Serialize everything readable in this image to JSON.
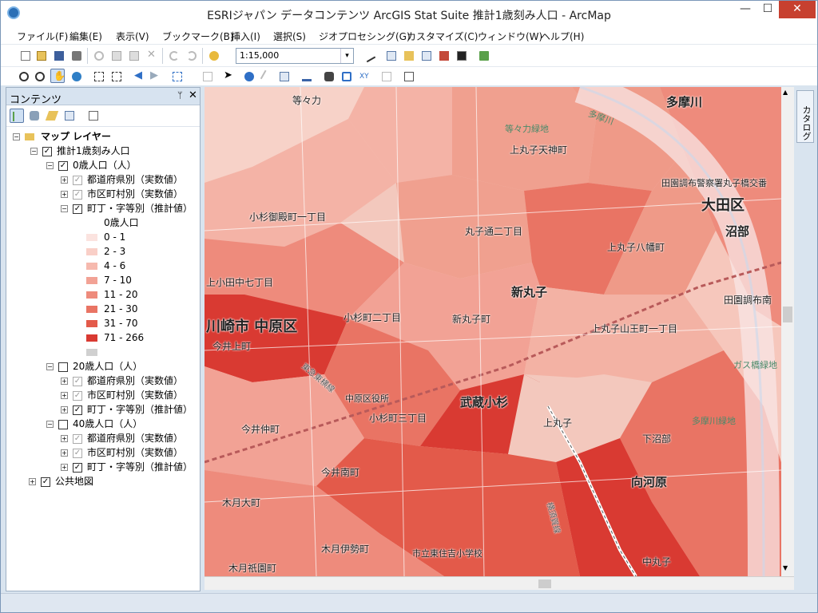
{
  "window": {
    "title": "ESRIジャパン データコンテンツ ArcGIS Stat Suite 推計1歳刻み人口 - ArcMap",
    "min_glyph": "—",
    "max_glyph": "☐",
    "close_glyph": "✕"
  },
  "menu": [
    "ファイル(F)",
    "編集(E)",
    "表示(V)",
    "ブックマーク(B)",
    "挿入(I)",
    "選択(S)",
    "ジオプロセシング(G)",
    "カスタマイズ(C)",
    "ウィンドウ(W)",
    "ヘルプ(H)"
  ],
  "toolbar": {
    "scale_value": "1:15,000",
    "dropdown_glyph": "▾"
  },
  "toc": {
    "title": "コンテンツ",
    "pin_glyph": "ᛘ",
    "close_glyph": "✕",
    "map_layer": "マップ レイヤー",
    "group": "推計1歳刻み人口",
    "age0": {
      "label": "0歳人口（人）",
      "pref": "都道府県別（実数値）",
      "city": "市区町村別（実数値）",
      "town": "町丁・字等別（推計値）",
      "legend_title": "0歳人口"
    },
    "legend": [
      {
        "label": "0 - 1",
        "color": "#fbe3df"
      },
      {
        "label": "2 - 3",
        "color": "#f9cfc7"
      },
      {
        "label": "4 - 6",
        "color": "#f6b9ae"
      },
      {
        "label": "7 - 10",
        "color": "#f2a295"
      },
      {
        "label": "11 - 20",
        "color": "#ee8b7c"
      },
      {
        "label": "21 - 30",
        "color": "#e97464"
      },
      {
        "label": "31 - 70",
        "color": "#e35a4a"
      },
      {
        "label": "71 - 266",
        "color": "#d93a32"
      },
      {
        "label": "",
        "color": "#d0d0d0"
      }
    ],
    "age20": {
      "label": "20歳人口（人）",
      "pref": "都道府県別（実数値）",
      "city": "市区町村別（実数値）",
      "town": "町丁・字等別（推計値）"
    },
    "age40": {
      "label": "40歳人口（人）",
      "pref": "都道府県別（実数値）",
      "city": "市区町村別（実数値）",
      "town": "町丁・字等別（推計値）"
    },
    "public_map": "公共地図"
  },
  "side_tab": "カタログ",
  "map_labels": {
    "todoroki": "等々力",
    "tamagawa": "多摩川",
    "tamagawa_river": "多摩川",
    "todoroki_ryokuchi": "等々力緑地",
    "kamimaruko_tenjin": "上丸子天神町",
    "denen_keisatsu": "田園調布警察署丸子橋交番",
    "ota": "大田区",
    "kosugi_goten": "小杉御殿町一丁目",
    "maruko_dori": "丸子通二丁目",
    "numabe": "沼部",
    "kamimaruko_hachiman": "上丸子八幡町",
    "kamikodanaka": "上小田中七丁目",
    "shinmaruko": "新丸子",
    "denen_chofu_minami": "田園調布南",
    "kawasaki_nakahara": "川崎市 中原区",
    "kosugi_2": "小杉町二丁目",
    "shinmaruko_cho": "新丸子町",
    "kamimaruko_sanno": "上丸子山王町一丁目",
    "imaikami": "今井上町",
    "gasbashi": "ガス橋緑地",
    "nakahara_office": "中原区役所",
    "musashikosugi": "武蔵小杉",
    "kosugi_3": "小杉町三丁目",
    "kamimaruko": "上丸子",
    "tamagawa_ryokuchi": "多摩川緑地",
    "imainaka": "今井仲町",
    "shimonumabe": "下沼部",
    "imaiminami": "今井南町",
    "mukaigawara": "向河原",
    "kizukiomachi": "木月大町",
    "kizukiise": "木月伊勢町",
    "school": "市立東住吉小学校",
    "kizukigion": "木月祇園町",
    "nakamaruko": "中丸子",
    "line_toyoko": "東急東横線",
    "line_yokosuka": "横須賀線"
  },
  "icons": [
    "app-icon",
    "new-icon",
    "open-icon",
    "save-icon",
    "print-icon",
    "cut-icon",
    "copy-icon",
    "paste-icon",
    "delete-icon",
    "undo-icon",
    "redo-icon",
    "add-data-icon",
    "zoom-in-icon",
    "zoom-out-icon",
    "pan-icon",
    "globe-icon",
    "identify-icon",
    "find-icon",
    "select-icon",
    "pin-icon",
    "close-icon",
    "catalog-icon"
  ]
}
